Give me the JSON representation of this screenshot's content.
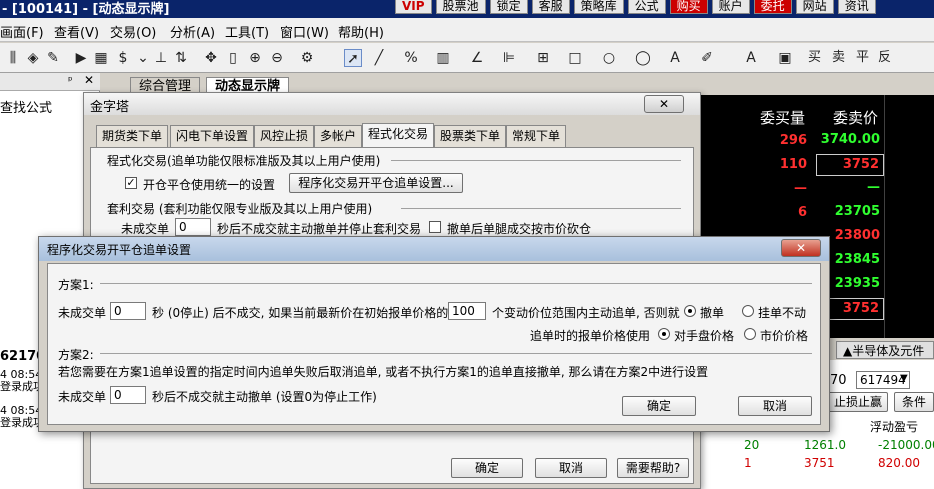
{
  "window": {
    "title": "- [100141] - [动态显示牌]"
  },
  "title_buttons": [
    {
      "label": "VIP",
      "style": "red"
    },
    {
      "label": "股票池",
      "style": ""
    },
    {
      "label": "锁定",
      "style": ""
    },
    {
      "label": "客服",
      "style": ""
    },
    {
      "label": "策略库",
      "style": ""
    },
    {
      "label": "公式",
      "style": ""
    },
    {
      "label": "购买",
      "style": "hot"
    },
    {
      "label": "账户",
      "style": ""
    },
    {
      "label": "委托",
      "style": "hot"
    },
    {
      "label": "网站",
      "style": ""
    },
    {
      "label": "资讯",
      "style": ""
    }
  ],
  "menu": [
    {
      "label": "画面(F)"
    },
    {
      "label": "查看(V)"
    },
    {
      "label": "交易(O)"
    },
    {
      "label": "分析(A)"
    },
    {
      "label": "工具(T)"
    },
    {
      "label": "窗口(W)"
    },
    {
      "label": "帮助(H)"
    }
  ],
  "toolbar_text": {
    "buy": "买",
    "sell": "卖",
    "flat": "平",
    "reverse": "反"
  },
  "left_panel": {
    "find_label": "查找公式",
    "code": "62170",
    "log": [
      {
        "time": "4 08:54",
        "text": "登录成功"
      },
      {
        "time": "4 08:54",
        "text": "登录成功"
      }
    ]
  },
  "doc_tabs": [
    {
      "label": "综合管理"
    },
    {
      "label": "动态显示牌"
    }
  ],
  "quote": {
    "headers": {
      "bid_qty": "委买量",
      "bid_price": "委卖价"
    },
    "rows": [
      {
        "qty": "296",
        "price": "3740.00",
        "qty_color": "#ff3030",
        "price_color": "#30ff30"
      },
      {
        "qty": "110",
        "price": "3752",
        "qty_color": "#ff3030",
        "price_color": "#ff3030",
        "boxed": true
      },
      {
        "qty": "—",
        "price": "—",
        "qty_color": "#ff3030",
        "price_color": "#30ff30"
      },
      {
        "qty": "6",
        "price": "23705",
        "qty_color": "#ff3030",
        "price_color": "#30ff30"
      },
      {
        "qty": "",
        "price": "23800",
        "qty_color": "#ff3030",
        "price_color": "#ff3030"
      },
      {
        "qty": "",
        "price": "23845",
        "qty_color": "#ff3030",
        "price_color": "#30ff30"
      },
      {
        "qty": "",
        "price": "23935",
        "qty_color": "#ff3030",
        "price_color": "#30ff30"
      },
      {
        "qty": "",
        "price": "3752",
        "qty_color": "#ff3030",
        "price_color": "#ff3030",
        "boxed": true
      }
    ]
  },
  "semiconductor_tab": "▲半导体及元件",
  "right_lower": {
    "price_prefix": "70",
    "account_select": "617494",
    "stop_button": "止损止赢",
    "cond_button": "条件",
    "float_pnl_header": "浮动盈亏",
    "rows": [
      {
        "qty": "20",
        "price": "1261.0",
        "pnl": "-21000.00",
        "qty_color": "#008000",
        "price_color": "#008000",
        "pnl_color": "#008000"
      },
      {
        "qty": "1",
        "price": "3751",
        "pnl": "820.00",
        "qty_color": "#d00000",
        "price_color": "#d00000",
        "pnl_color": "#d00000"
      }
    ]
  },
  "pyramid_dialog": {
    "title": "金字塔",
    "tabs": [
      {
        "label": "期货类下单"
      },
      {
        "label": "闪电下单设置"
      },
      {
        "label": "风控止损"
      },
      {
        "label": "多帐户"
      },
      {
        "label": "程式化交易",
        "active": true
      },
      {
        "label": "股票类下单"
      },
      {
        "label": "常规下单"
      }
    ],
    "prog_group_title": "程式化交易(追单功能仅限标准版及其以上用户使用)",
    "unified_checkbox_label": "开仓平仓使用统一的设置",
    "prog_settings_button": "程序化交易开平仓追单设置...",
    "arb_group_title": "套利交易 (套利功能仅限专业版及其以上用户使用)",
    "arb_unfilled_label": "未成交单",
    "arb_unfilled_value": "0",
    "arb_after_label": "秒后不成交就主动撤单并停止套利交易",
    "arb_chase_label": "撤单后单腿成交按市价砍仓",
    "ok": "确定",
    "cancel": "取消",
    "help": "需要帮助?"
  },
  "chase_dialog": {
    "title": "程序化交易开平仓追单设置",
    "plan1_title": "方案1:",
    "p1_unfilled_label": "未成交单",
    "p1_unfilled_value": "0",
    "p1_text": "秒 (0停止) 后不成交, 如果当前最新价在初始报单价格的",
    "p1_ticks_value": "100",
    "p1_text2": "个变动价位范围内主动追单, 否则就",
    "p1_opt_cancel": "撤单",
    "p1_opt_hold": "挂单不动",
    "p1_price_label": "追单时的报单价格使用",
    "p1_opt_counter": "对手盘价格",
    "p1_opt_market": "市价价格",
    "plan2_title": "方案2:",
    "p2_desc": "若您需要在方案1追单设置的指定时间内追单失败后取消追单, 或者不执行方案1的追单直接撤单, 那么请在方案2中进行设置",
    "p2_unfilled_label": "未成交单",
    "p2_unfilled_value": "0",
    "p2_text": "秒后不成交就主动撤单 (设置0为停止工作)",
    "ok": "确定",
    "cancel": "取消"
  }
}
